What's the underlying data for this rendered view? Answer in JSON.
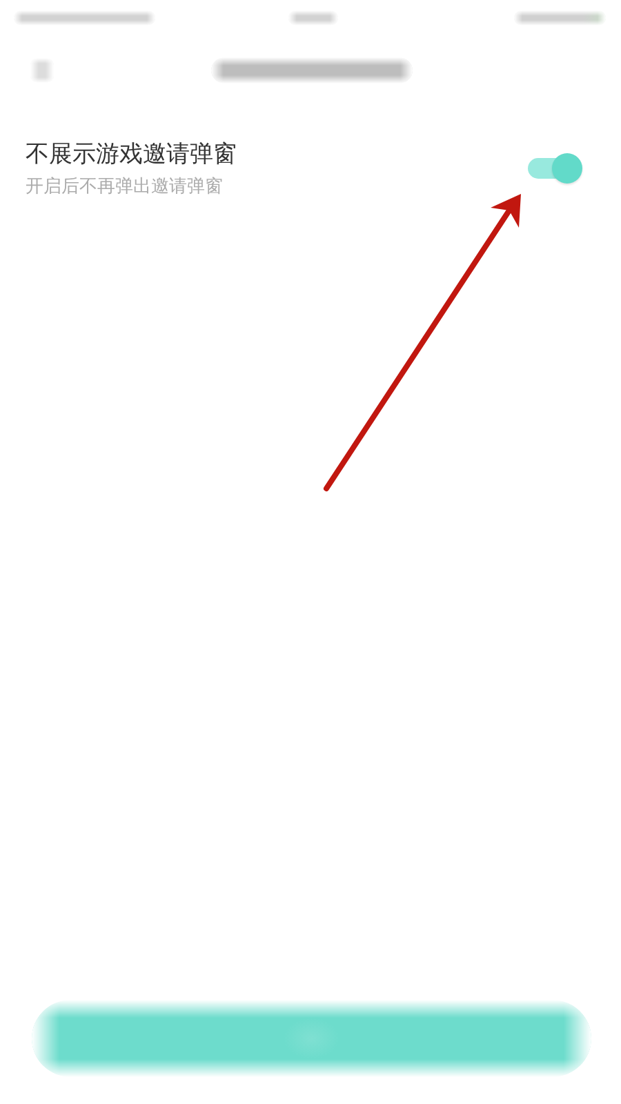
{
  "settings": [
    {
      "title": "不展示游戏邀请弹窗",
      "subtitle": "开启后不再弹出邀请弹窗",
      "on": true
    }
  ],
  "annotations": [
    {
      "kind": "arrow"
    }
  ]
}
